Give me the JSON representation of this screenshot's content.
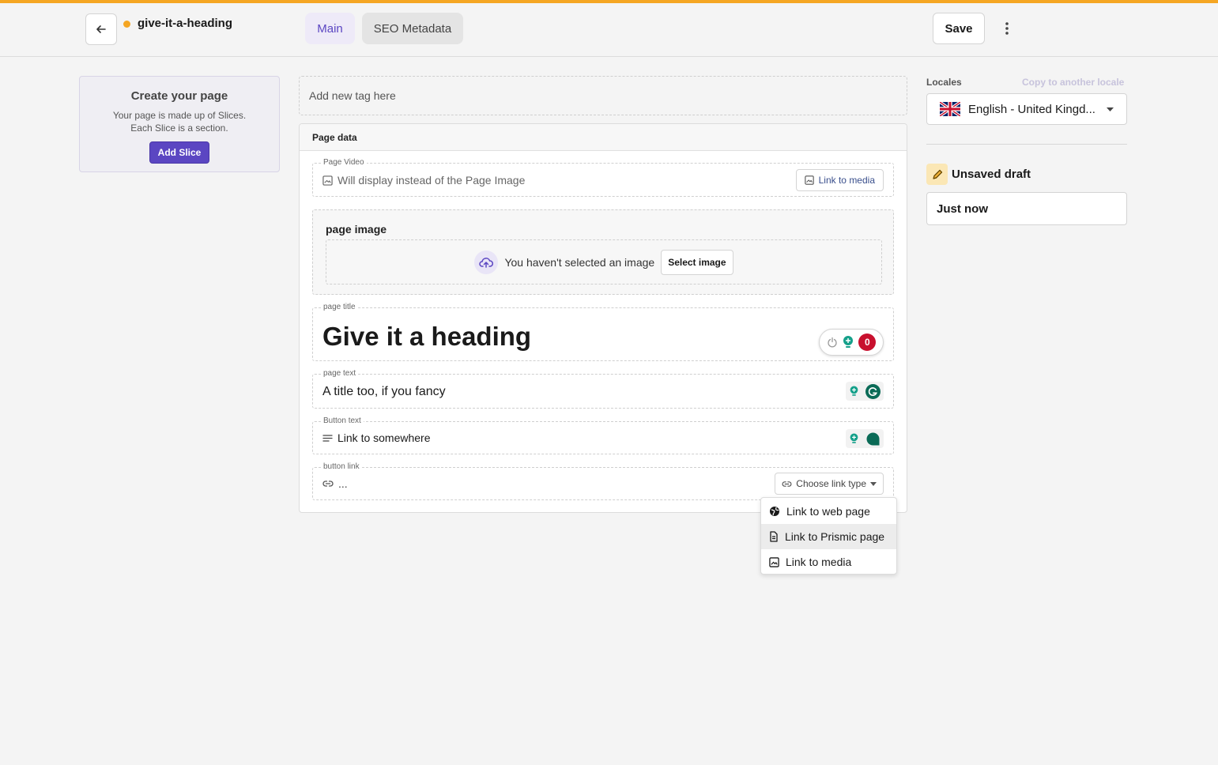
{
  "header": {
    "document_name": "give-it-a-heading",
    "tabs": [
      {
        "label": "Main"
      },
      {
        "label": "SEO Metadata"
      }
    ],
    "save_label": "Save"
  },
  "slices": {
    "title": "Create your page",
    "desc_line1": "Your page is made up of Slices.",
    "desc_line2": "Each Slice is a section.",
    "add_label": "Add Slice"
  },
  "tags": {
    "placeholder": "Add new tag here"
  },
  "page_data": {
    "heading": "Page data",
    "video": {
      "label": "Page Video",
      "placeholder": "Will display instead of the Page Image",
      "button": "Link to media"
    },
    "image": {
      "label": "page image",
      "empty_text": "You haven't selected an image",
      "button": "Select image"
    },
    "title": {
      "label": "page title",
      "value": "Give it a heading",
      "grammarly_count": "0"
    },
    "text": {
      "label": "page text",
      "value": "A title too, if you fancy"
    },
    "button_text": {
      "label": "Button text",
      "value": "Link to somewhere"
    },
    "button_link": {
      "label": "button link",
      "value": "...",
      "chooser": "Choose link type"
    }
  },
  "link_menu": {
    "items": [
      {
        "label": "Link to web page",
        "icon": "globe-icon"
      },
      {
        "label": "Link to Prismic page",
        "icon": "document-icon"
      },
      {
        "label": "Link to media",
        "icon": "image-icon"
      }
    ],
    "highlighted_index": 1
  },
  "sidebar": {
    "locales_label": "Locales",
    "copy_locale": "Copy to another locale",
    "locale_value": "English - United Kingd...",
    "status_title": "Unsaved draft",
    "status_time": "Just now"
  },
  "colors": {
    "accent": "#5b46c2",
    "draft": "#f5a623",
    "grammarly": "#0b6b57",
    "grammarly_alert": "#c8102e"
  }
}
